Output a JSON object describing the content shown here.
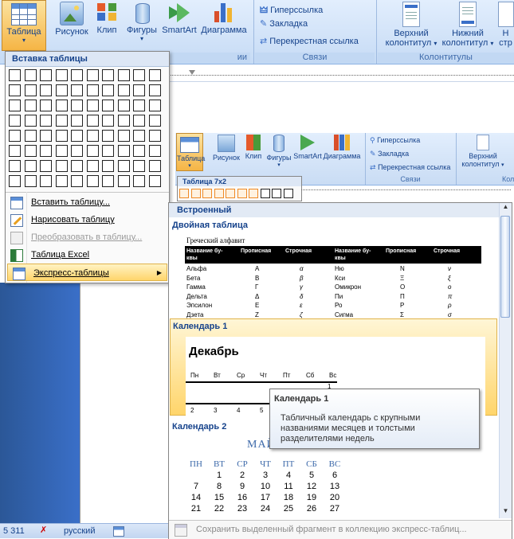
{
  "ribbon": {
    "table_btn": "Таблица",
    "picture_btn": "Рисунок",
    "clip_btn": "Клип",
    "shapes_btn": "Фигуры",
    "smartart_btn": "SmartArt",
    "chart_btn": "Диаграмма",
    "links": {
      "hyperlink": "Гиперссылка",
      "bookmark": "Закладка",
      "crossref": "Перекрестная ссылка",
      "group": "Связи"
    },
    "header_btn": [
      "Верхний",
      "колонтитул"
    ],
    "footer_btn": [
      "Нижний",
      "колонтитул"
    ],
    "page_btn": [
      "Н",
      "стр"
    ],
    "hf_group": "Колонтитулы",
    "illus_group_tail": "ии"
  },
  "table_menu": {
    "title": "Вставка таблицы",
    "grid_cols": 10,
    "grid_rows": 8,
    "items": [
      {
        "label": "Вставить таблицу...",
        "enabled": true
      },
      {
        "label": "Нарисовать таблицу",
        "enabled": true
      },
      {
        "label": "Преобразовать в таблицу...",
        "enabled": false
      },
      {
        "label": "Таблица Excel",
        "enabled": true
      },
      {
        "label": "Экспресс-таблицы",
        "enabled": true,
        "submenu": true
      }
    ]
  },
  "inner_ribbon": {
    "table_btn": "Таблица",
    "picture_btn": "Рисунок",
    "clip_btn": "Клип",
    "shapes_btn": "Фигуры",
    "smartart_btn": "SmartArt",
    "chart_btn": "Диаграмма",
    "hyperlink": "Гиперссылка",
    "bookmark": "Закладка",
    "crossref": "Перекрестная ссылка",
    "links_group": "Связи",
    "header_btn": [
      "Верхний",
      "колонтитул"
    ],
    "col_tail": "Кол",
    "grid_label": "Таблица 7x2"
  },
  "gallery": {
    "header": "Встроенный",
    "sections": {
      "double": "Двойная таблица",
      "cal1": "Календарь 1",
      "cal2": "Календарь 2"
    },
    "greek": {
      "caption": "Греческий алфавит",
      "headers": [
        "Название бу-квы",
        "Прописная",
        "Строчная",
        "Название бу-квы",
        "Прописная",
        "Строчная"
      ],
      "rows": [
        [
          "Альфа",
          "Α",
          "α",
          "Ню",
          "Ν",
          "ν"
        ],
        [
          "Бета",
          "Β",
          "β",
          "Кси",
          "Ξ",
          "ξ"
        ],
        [
          "Гамма",
          "Γ",
          "γ",
          "Омикрон",
          "Ο",
          "ο"
        ],
        [
          "Дельта",
          "Δ",
          "δ",
          "Пи",
          "Π",
          "π"
        ],
        [
          "Эпсилон",
          "Ε",
          "ε",
          "Ро",
          "Ρ",
          "ρ"
        ],
        [
          "Дзета",
          "Ζ",
          "ζ",
          "Сигма",
          "Σ",
          "σ"
        ]
      ]
    },
    "cal1": {
      "month": "Декабрь",
      "days": [
        "Пн",
        "Вт",
        "Ср",
        "Чт",
        "Пт",
        "Сб",
        "Вс"
      ],
      "first": "1",
      "row2": [
        "2",
        "3",
        "4",
        "5"
      ]
    },
    "cal2": {
      "month": "МАЙ",
      "days": [
        "ПН",
        "ВТ",
        "СР",
        "ЧТ",
        "ПТ",
        "СБ",
        "ВС"
      ],
      "weeks": [
        [
          "",
          "1",
          "2",
          "3",
          "4",
          "5",
          "6"
        ],
        [
          "7",
          "8",
          "9",
          "10",
          "11",
          "12",
          "13"
        ],
        [
          "14",
          "15",
          "16",
          "17",
          "18",
          "19",
          "20"
        ],
        [
          "21",
          "22",
          "23",
          "24",
          "25",
          "26",
          "27"
        ]
      ]
    },
    "save_selection": "Сохранить выделенный фрагмент в коллекцию экспресс-таблиц..."
  },
  "tooltip": {
    "title": "Календарь 1",
    "body": [
      "Табличный календарь с крупными",
      "названиями месяцев и толстыми",
      "разделителями недель"
    ]
  },
  "status": {
    "page": "5 311",
    "lang": "русский"
  },
  "colors": {
    "ribbon_text": "#15428b",
    "hover_orange": "#ffd56b",
    "accent_blue": "#3e6aaa"
  }
}
